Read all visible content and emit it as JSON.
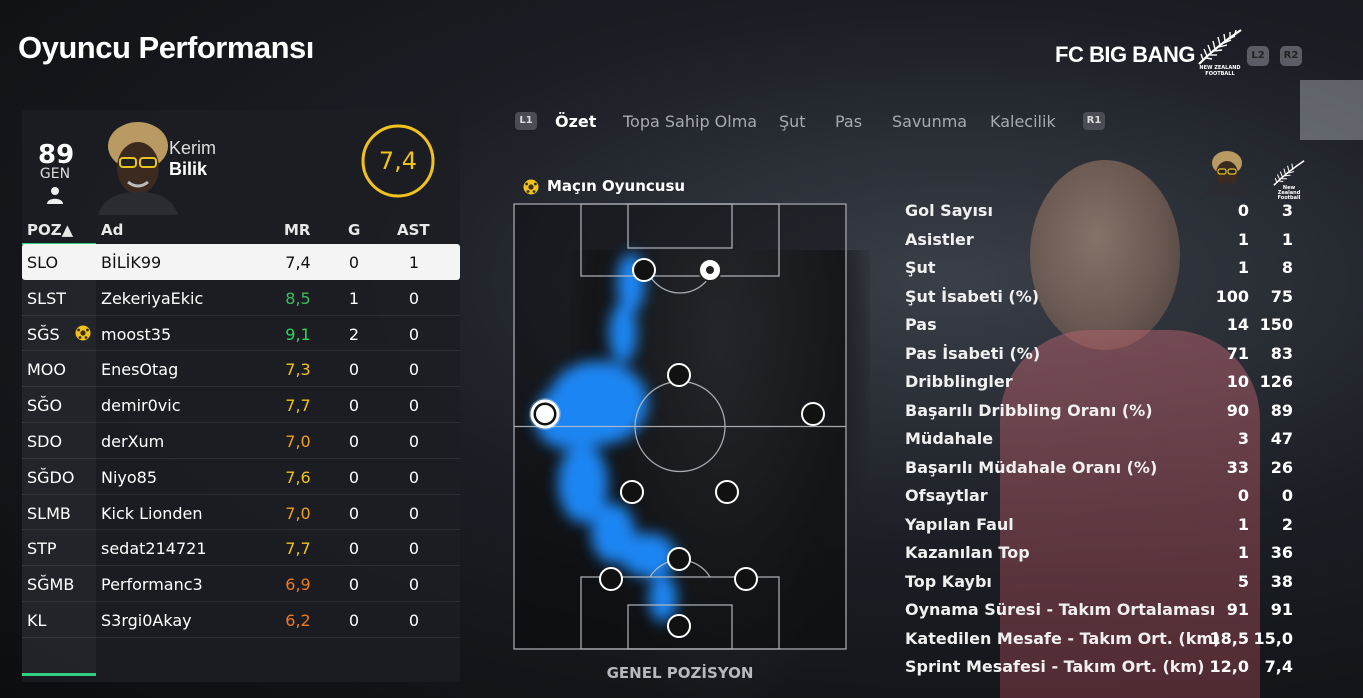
{
  "header": {
    "title": "Oyuncu Performansı",
    "club_name": "FC BIG BANG",
    "logo_caption": "NEW ZEALAND FOOTBALL",
    "btn_l2": "L2",
    "btn_r2": "R2"
  },
  "player": {
    "overall": "89",
    "overall_label": "GEN",
    "first_name": "Kerim",
    "last_name": "Bilik",
    "match_rating": "7,4",
    "rating_color": "#f0c21a"
  },
  "table": {
    "headers": {
      "poz": "POZ▲",
      "name": "Ad",
      "mr": "MR",
      "g": "G",
      "ast": "AST"
    },
    "rows": [
      {
        "poz": "SLO",
        "name": "BİLİK99",
        "mr": "7,4",
        "g": "0",
        "ast": "1",
        "mr_color": "#111111",
        "selected": true
      },
      {
        "poz": "SLST",
        "name": "ZekeriyaEkic",
        "mr": "8,5",
        "g": "1",
        "ast": "0",
        "mr_color": "#3dbb63"
      },
      {
        "poz": "SĞS",
        "name": "moost35",
        "mr": "9,1",
        "g": "2",
        "ast": "0",
        "mr_color": "#2fd45a",
        "motm": true
      },
      {
        "poz": "MOO",
        "name": "EnesOtag",
        "mr": "7,3",
        "g": "0",
        "ast": "0",
        "mr_color": "#f0c21a"
      },
      {
        "poz": "SĞO",
        "name": "demir0vic",
        "mr": "7,7",
        "g": "0",
        "ast": "0",
        "mr_color": "#f0c21a"
      },
      {
        "poz": "SDO",
        "name": "derXum",
        "mr": "7,0",
        "g": "0",
        "ast": "0",
        "mr_color": "#f0a01a"
      },
      {
        "poz": "SĞDO",
        "name": "Niyo85",
        "mr": "7,6",
        "g": "0",
        "ast": "0",
        "mr_color": "#f0c21a"
      },
      {
        "poz": "SLMB",
        "name": "Kick Lionden",
        "mr": "7,0",
        "g": "0",
        "ast": "0",
        "mr_color": "#f0a01a"
      },
      {
        "poz": "STP",
        "name": "sedat214721",
        "mr": "7,7",
        "g": "0",
        "ast": "0",
        "mr_color": "#f0c21a"
      },
      {
        "poz": "SĞMB",
        "name": "Performanc3",
        "mr": "6,9",
        "g": "0",
        "ast": "0",
        "mr_color": "#ee7b1e"
      },
      {
        "poz": "KL",
        "name": "S3rgi0Akay",
        "mr": "6,2",
        "g": "0",
        "ast": "0",
        "mr_color": "#ee7b1e"
      }
    ]
  },
  "tabs": {
    "l1": "L1",
    "r1": "R1",
    "items": [
      "Özet",
      "Topa Sahip Olma",
      "Şut",
      "Pas",
      "Savunma",
      "Kalecilik"
    ],
    "active_index": 0
  },
  "pitch": {
    "motm_label": "Maçın Oyuncusu",
    "caption": "GENEL POZİSYON",
    "heat_color": "#1e90ff"
  },
  "stats": {
    "col2_caption": "New Zealand Football",
    "rows": [
      {
        "label": "Gol Sayısı",
        "player": "0",
        "team": "3"
      },
      {
        "label": "Asistler",
        "player": "1",
        "team": "1"
      },
      {
        "label": "Şut",
        "player": "1",
        "team": "8"
      },
      {
        "label": "Şut İsabeti (%)",
        "player": "100",
        "team": "75"
      },
      {
        "label": "Pas",
        "player": "14",
        "team": "150"
      },
      {
        "label": "Pas İsabeti (%)",
        "player": "71",
        "team": "83"
      },
      {
        "label": "Dribblingler",
        "player": "10",
        "team": "126"
      },
      {
        "label": "Başarılı Dribbling Oranı (%)",
        "player": "90",
        "team": "89"
      },
      {
        "label": "Müdahale",
        "player": "3",
        "team": "47"
      },
      {
        "label": "Başarılı Müdahale Oranı (%)",
        "player": "33",
        "team": "26"
      },
      {
        "label": "Ofsaytlar",
        "player": "0",
        "team": "0"
      },
      {
        "label": "Yapılan Faul",
        "player": "1",
        "team": "2"
      },
      {
        "label": "Kazanılan Top",
        "player": "1",
        "team": "36"
      },
      {
        "label": "Top Kaybı",
        "player": "5",
        "team": "38"
      },
      {
        "label": "Oynama Süresi - Takım Ortalaması",
        "player": "91",
        "team": "91"
      },
      {
        "label": "Katedilen Mesafe - Takım Ort. (km)",
        "player": "18,5",
        "team": "15,0"
      },
      {
        "label": "Sprint Mesafesi - Takım Ort. (km)",
        "player": "12,0",
        "team": "7,4"
      }
    ]
  }
}
